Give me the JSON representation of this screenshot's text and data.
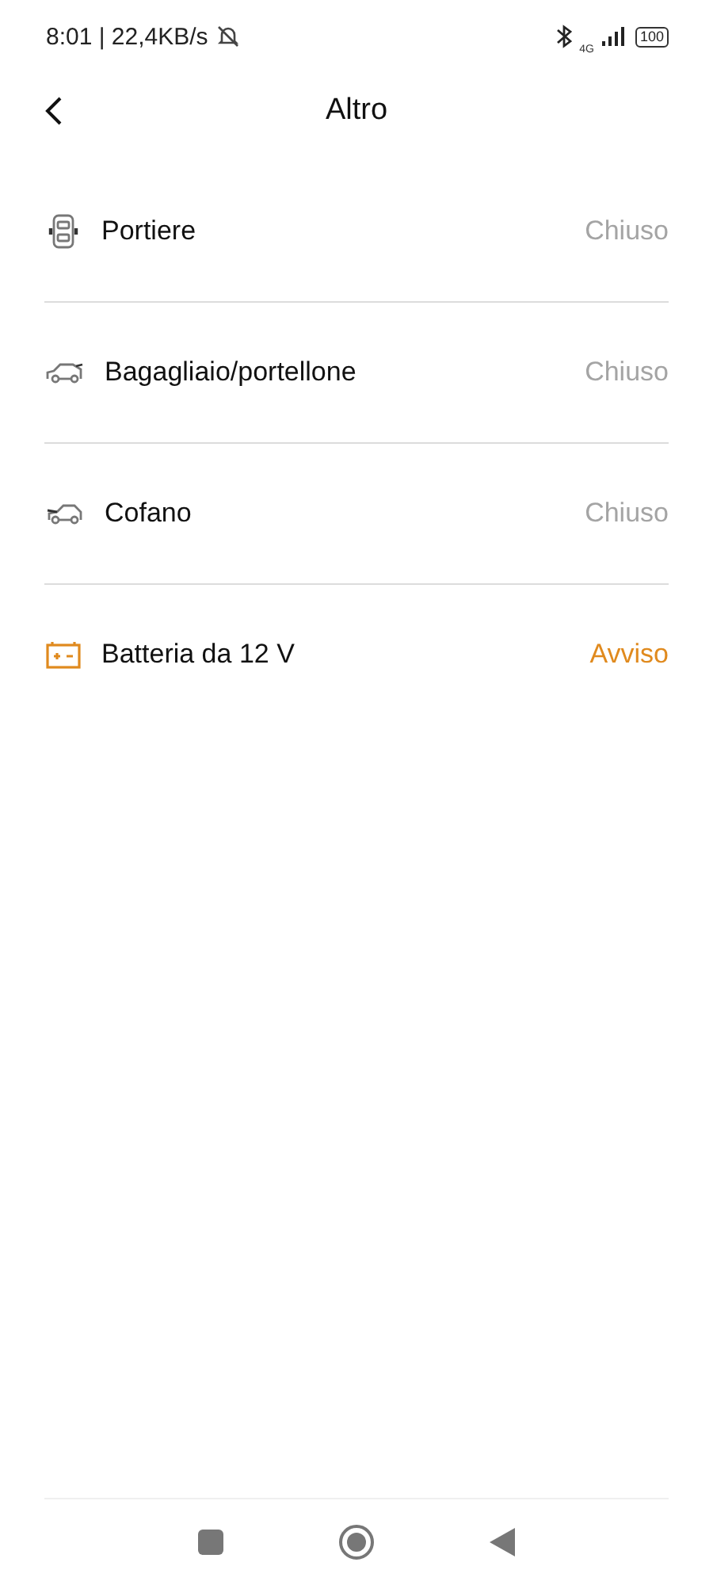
{
  "status_bar": {
    "time_speed": "8:01 | 22,4KB/s",
    "network": "4G",
    "battery": "100"
  },
  "header": {
    "title": "Altro"
  },
  "items": [
    {
      "kind": "doors",
      "label": "Portiere",
      "status": "Chiuso",
      "warning": false
    },
    {
      "kind": "trunk",
      "label": "Bagagliaio/portellone",
      "status": "Chiuso",
      "warning": false
    },
    {
      "kind": "hood",
      "label": "Cofano",
      "status": "Chiuso",
      "warning": false
    },
    {
      "kind": "battery",
      "label": "Batteria da 12 V",
      "status": "Avviso",
      "warning": true
    }
  ]
}
